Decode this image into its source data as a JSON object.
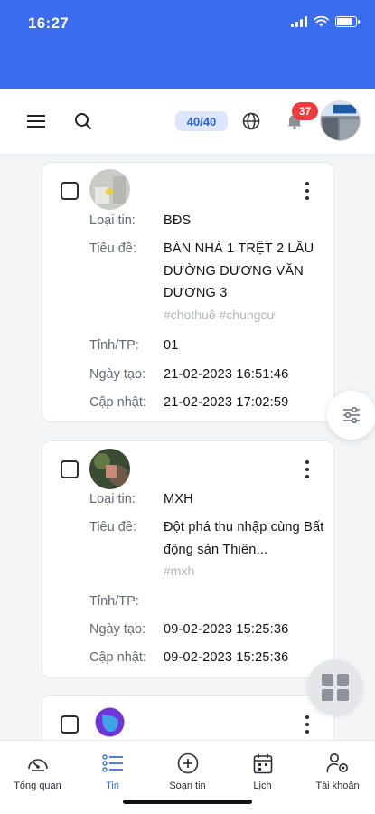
{
  "status_bar": {
    "time": "16:27"
  },
  "toolbar": {
    "count": "40/40",
    "notifications": "37"
  },
  "cards": [
    {
      "rows": [
        {
          "label": "Loại tin:",
          "value": "BĐS"
        },
        {
          "label": "Tiêu đề:",
          "value": "BÁN NHÀ 1 TRỆT 2 LẦU ĐƯỜNG DƯƠNG VĂN DƯƠNG 3"
        },
        {
          "label": "Tỉnh/TP:",
          "value": "01"
        },
        {
          "label": "Ngày tạo:",
          "value": "21-02-2023 16:51:46"
        },
        {
          "label": "Cập nhật:",
          "value": "21-02-2023 17:02:59"
        }
      ],
      "tags": "#chothuê #chungcư"
    },
    {
      "rows": [
        {
          "label": "Loại tin:",
          "value": "MXH"
        },
        {
          "label": "Tiêu đề:",
          "value": "Đột phá thu nhập cùng Bất động sản Thiên..."
        },
        {
          "label": "Tỉnh/TP:",
          "value": ""
        },
        {
          "label": "Ngày tạo:",
          "value": "09-02-2023 15:25:36"
        },
        {
          "label": "Cập nhật:",
          "value": "09-02-2023 15:25:36"
        }
      ],
      "tags": "#mxh"
    }
  ],
  "bottom_nav": [
    {
      "label": "Tổng quan",
      "icon": "gauge-icon"
    },
    {
      "label": "Tin",
      "icon": "list-icon"
    },
    {
      "label": "Soạn tin",
      "icon": "plus-circle-icon"
    },
    {
      "label": "Lịch",
      "icon": "calendar-icon"
    },
    {
      "label": "Tài khoản",
      "icon": "account-settings-icon"
    }
  ],
  "colors": {
    "header_blue": "#3b6cf0",
    "active_nav": "#3d6ee8",
    "badge_red": "#ef3b3f"
  }
}
